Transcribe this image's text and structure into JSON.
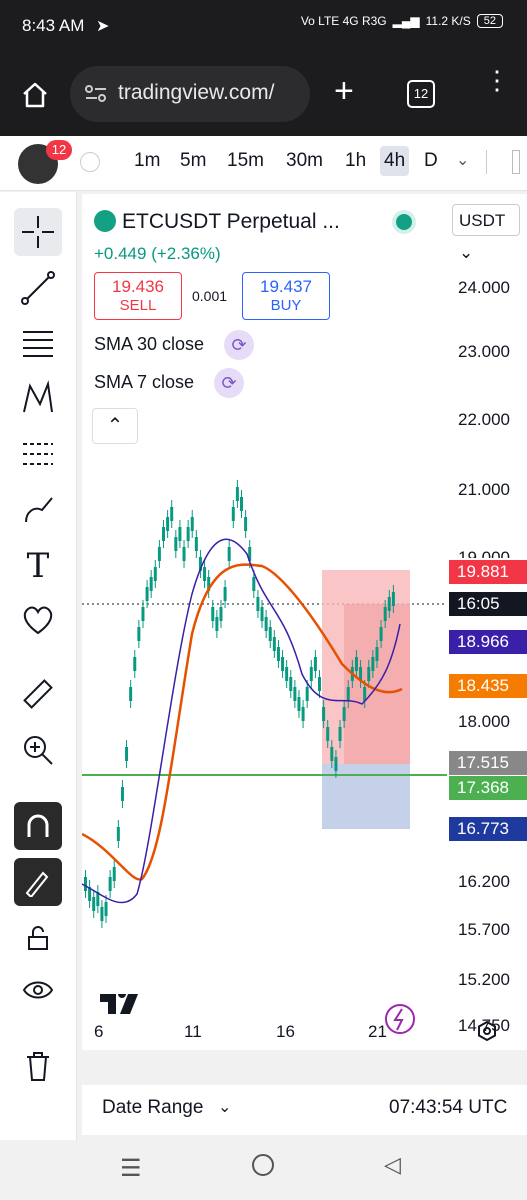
{
  "status_bar": {
    "time": "8:43 AM",
    "network": "Vo LTE 4G R3G",
    "speed": "11.2 K/S",
    "battery": "52"
  },
  "browser": {
    "url": "tradingview.com/",
    "tab_count": "12"
  },
  "toolbar": {
    "notification_count": "12",
    "intervals": [
      "1m",
      "5m",
      "15m",
      "30m",
      "1h",
      "4h",
      "D"
    ],
    "active_interval": "4h"
  },
  "symbol": {
    "name": "ETCUSDT Perpetual ...",
    "change": "+0.449 (+2.36%)",
    "currency": "USDT",
    "sell_price": "19.436",
    "sell_label": "SELL",
    "spread": "0.001",
    "buy_price": "19.437",
    "buy_label": "BUY"
  },
  "indicators": [
    {
      "label": "SMA 30 close"
    },
    {
      "label": "SMA 7 close"
    }
  ],
  "price_axis": [
    "24.000",
    "23.000",
    "22.000",
    "21.000",
    "19.000",
    "18.000",
    "16.200",
    "15.700",
    "15.200",
    "14.750"
  ],
  "price_labels": [
    {
      "value": "19.881",
      "color": "#f23645"
    },
    {
      "value": "16:05",
      "color": "#131722"
    },
    {
      "value": "18.966",
      "color": "#3a1fa8"
    },
    {
      "value": "18.435",
      "color": "#f57c00"
    },
    {
      "value": "17.515",
      "color": "#888888"
    },
    {
      "value": "17.368",
      "color": "#4caf50"
    },
    {
      "value": "16.773",
      "color": "#1e3a9e"
    }
  ],
  "time_axis": [
    "6",
    "11",
    "16",
    "21"
  ],
  "footer": {
    "date_range": "Date Range",
    "clock": "07:43:54 UTC"
  },
  "colors": {
    "up": "#089981",
    "sma30": "#e65100",
    "sma7": "#3a1fa8",
    "support": "#4caf50"
  }
}
